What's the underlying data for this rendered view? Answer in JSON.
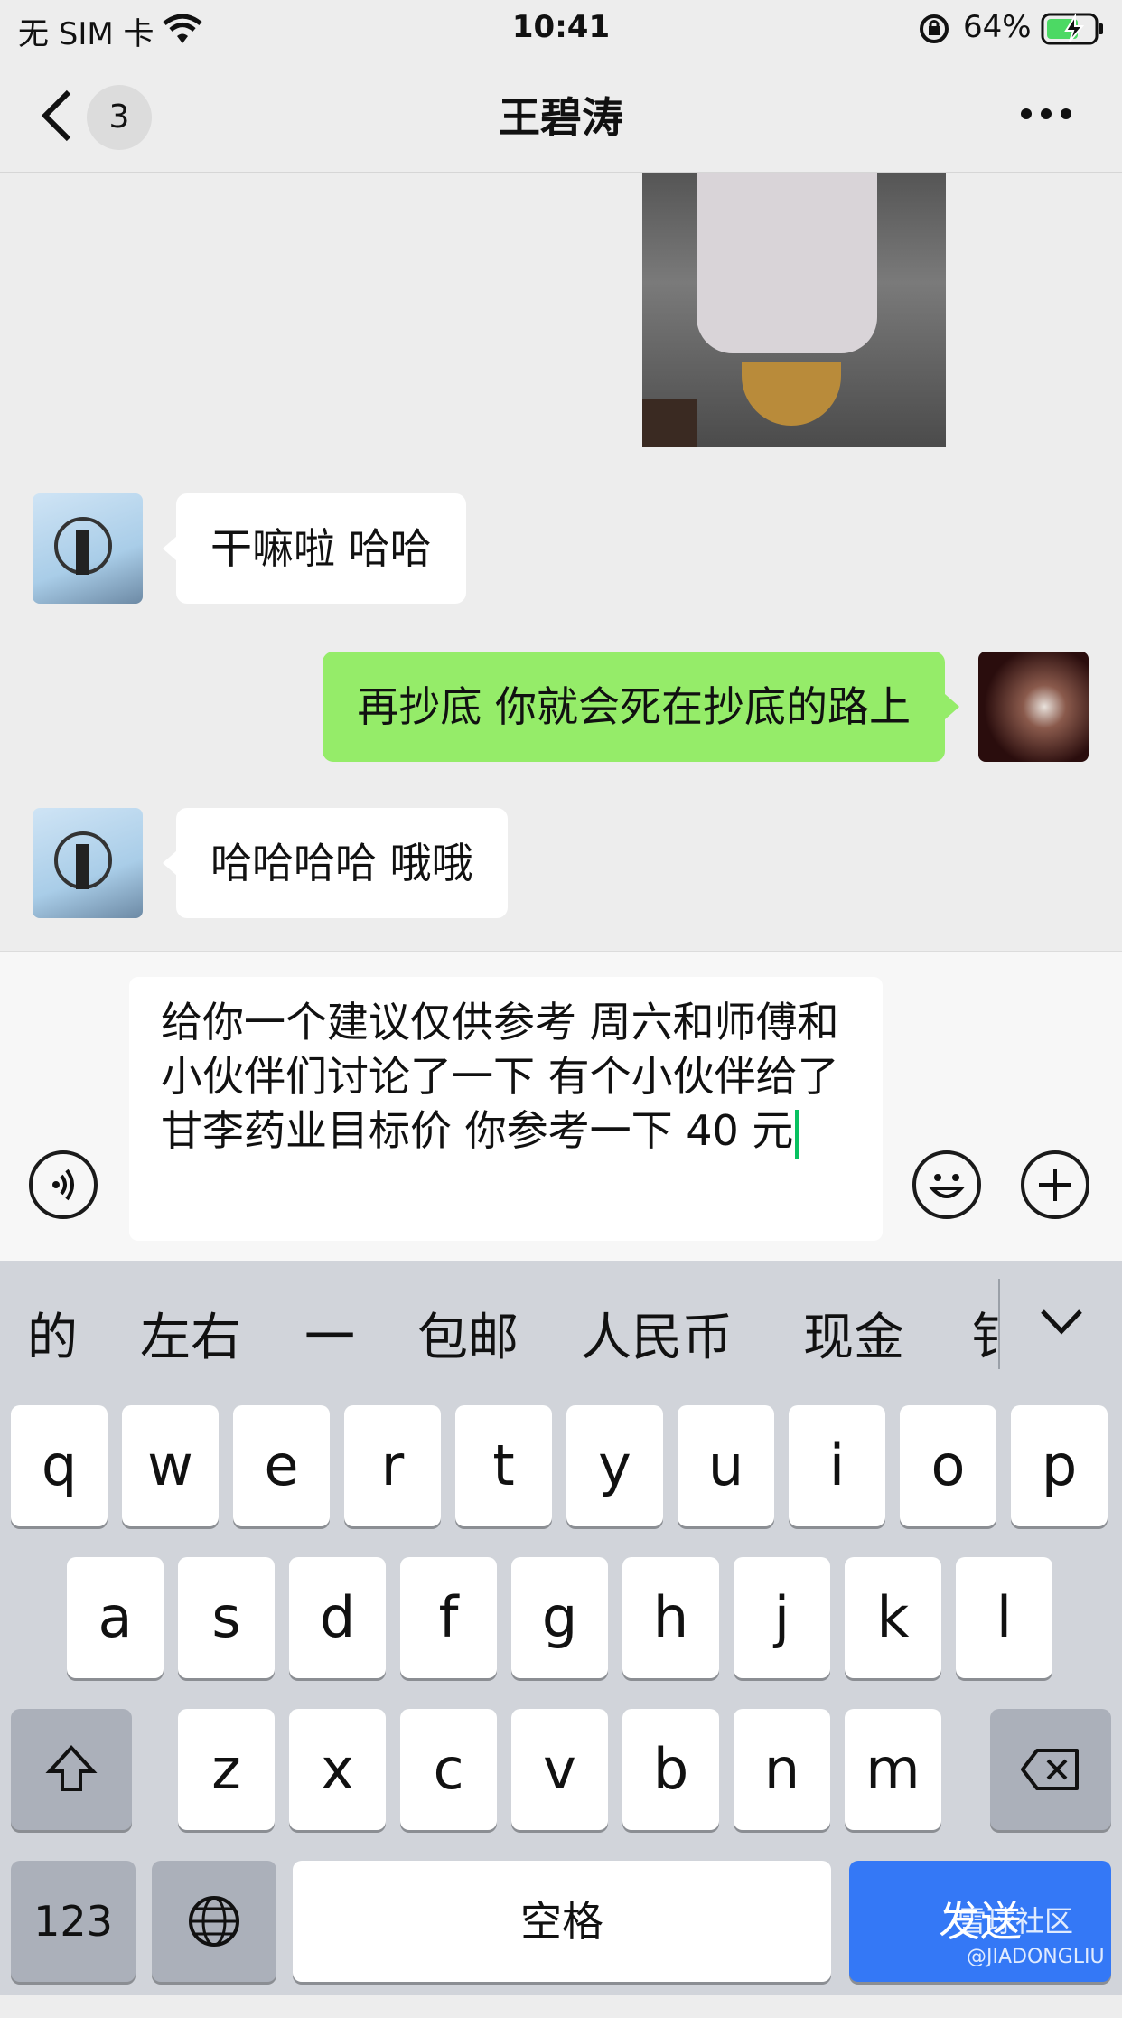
{
  "status_bar": {
    "carrier": "无 SIM 卡",
    "time": "10:41",
    "battery": "64%"
  },
  "nav": {
    "title": "王碧涛",
    "back_badge": "3",
    "more_label": "···"
  },
  "messages": [
    {
      "side": "left",
      "text": "干嘛啦 哈哈"
    },
    {
      "side": "right",
      "text": "再抄底 你就会死在抄底的路上"
    },
    {
      "side": "left",
      "text": "哈哈哈哈 哦哦"
    }
  ],
  "composer": {
    "text": "给你一个建议仅供参考 周六和师傅和小伙伴们讨论了一下 有个小伙伴给了甘李药业目标价 你参考一下 40 元"
  },
  "candidates": [
    "的",
    "左右",
    "一",
    "包邮",
    "人民币",
    "现金",
    "钅"
  ],
  "keyboard": {
    "row1": [
      "q",
      "w",
      "e",
      "r",
      "t",
      "y",
      "u",
      "i",
      "o",
      "p"
    ],
    "row2": [
      "a",
      "s",
      "d",
      "f",
      "g",
      "h",
      "j",
      "k",
      "l"
    ],
    "row3": [
      "z",
      "x",
      "c",
      "v",
      "b",
      "n",
      "m"
    ],
    "num_label": "123",
    "space_label": "空格",
    "send_label": "发送",
    "watermark": "雪球社区",
    "watermark_sub": "@JIADONGLIU"
  },
  "colors": {
    "accent_green": "#95ec69",
    "send_blue": "#3478f6",
    "caret": "#07c160"
  }
}
